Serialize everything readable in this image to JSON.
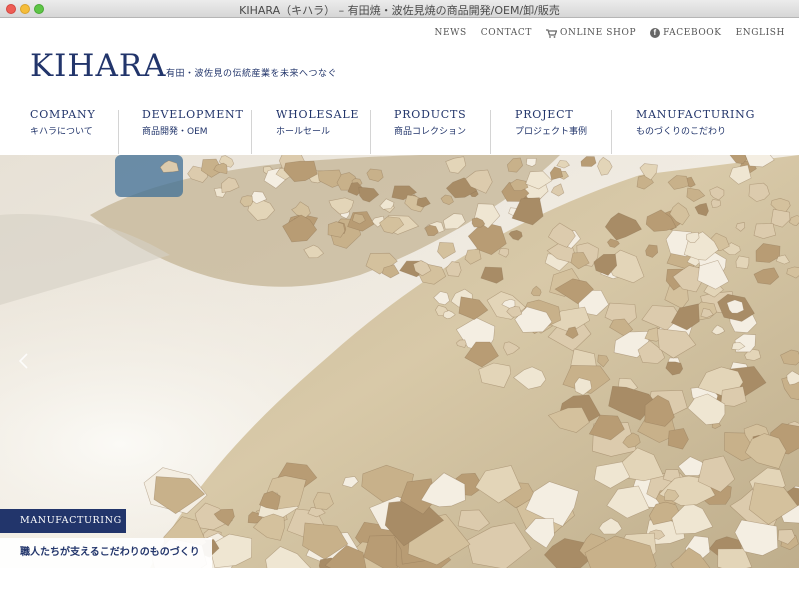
{
  "window": {
    "title": "KIHARA（キハラ） – 有田焼・波佐見焼の商品開発/OEM/卸/販売"
  },
  "header": {
    "logo": "KIHARA",
    "tagline": "有田・波佐見の伝統産業を未来へつなぐ"
  },
  "topnav": {
    "news": "NEWS",
    "contact": "CONTACT",
    "online_shop": "ONLINE SHOP",
    "facebook": "FACEBOOK",
    "english": "ENGLISH",
    "icons": {
      "cart": "cart-icon",
      "facebook": "facebook-icon"
    }
  },
  "mainnav": [
    {
      "en": "COMPANY",
      "jp": "キハラについて"
    },
    {
      "en": "DEVELOPMENT",
      "jp": "商品開発・OEM"
    },
    {
      "en": "WHOLESALE",
      "jp": "ホールセール"
    },
    {
      "en": "PRODUCTS",
      "jp": "商品コレクション"
    },
    {
      "en": "PROJECT",
      "jp": "プロジェクト事例"
    },
    {
      "en": "MANUFACTURING",
      "jp": "ものづくりのこだわり"
    }
  ],
  "hero": {
    "caption_tag": "MANUFACTURING",
    "caption_text": "職人たちが支えるこだわりのものづくり",
    "prev_arrow": "chevron-left-icon"
  },
  "colors": {
    "brand_navy": "#22356b",
    "accent_white": "#ffffff"
  }
}
